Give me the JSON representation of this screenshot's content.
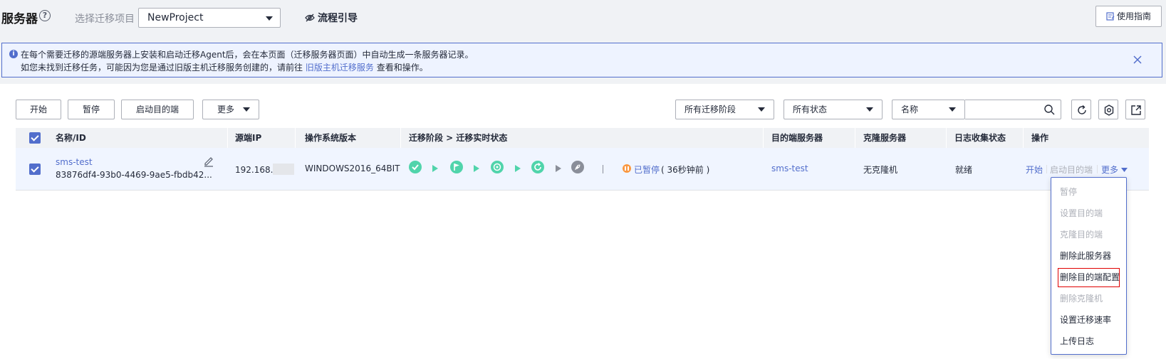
{
  "header": {
    "title": "服务器",
    "project_label": "选择迁移项目",
    "project_value": "NewProject",
    "flow_guide": "流程引导",
    "guide_button": "使用指南"
  },
  "notice": {
    "line1": "在每个需要迁移的源端服务器上安装和启动迁移Agent后，会在本页面（迁移服务器页面）中自动生成一条服务器记录。",
    "line2_prefix": "如您未找到迁移任务，可能因为您是通过旧版主机迁移服务创建的，请前往",
    "line2_link": "旧版主机迁移服务",
    "line2_suffix": "查看和操作。"
  },
  "toolbar": {
    "start": "开始",
    "pause": "暂停",
    "start_target": "启动目的端",
    "more": "更多",
    "stage_filter": "所有迁移阶段",
    "status_filter": "所有状态",
    "search_field": "名称"
  },
  "table": {
    "columns": [
      "名称/ID",
      "源端IP",
      "操作系统版本",
      "迁移阶段 > 迁移实时状态",
      "目的端服务器",
      "克隆服务器",
      "日志收集状态",
      "操作"
    ],
    "rows": [
      {
        "name": "sms-test",
        "id": "83876df4-93b0-4469-9ae5-fbdb42...",
        "ip": "192.168.",
        "os": "WINDOWS2016_64BIT",
        "status": "已暂停",
        "status_time": "( 36秒钟前 )",
        "target": "sms-test",
        "clone": "无克隆机",
        "log_status": "就绪",
        "op_start": "开始",
        "op_start_target": "启动目的端",
        "op_more": "更多"
      }
    ]
  },
  "dropdown": {
    "items": [
      {
        "label": "暂停",
        "disabled": true
      },
      {
        "label": "设置目的端",
        "disabled": true
      },
      {
        "label": "克隆目的端",
        "disabled": true
      },
      {
        "label": "删除此服务器",
        "disabled": false
      },
      {
        "label": "删除目的端配置",
        "disabled": false
      },
      {
        "label": "删除克隆机",
        "disabled": true
      },
      {
        "label": "设置迁移速率",
        "disabled": false
      },
      {
        "label": "上传日志",
        "disabled": false
      }
    ]
  },
  "colors": {
    "accent": "#526ecc",
    "stage_done": "#50d4ab",
    "paused": "#fa9841",
    "highlight_border": "#e00000"
  }
}
